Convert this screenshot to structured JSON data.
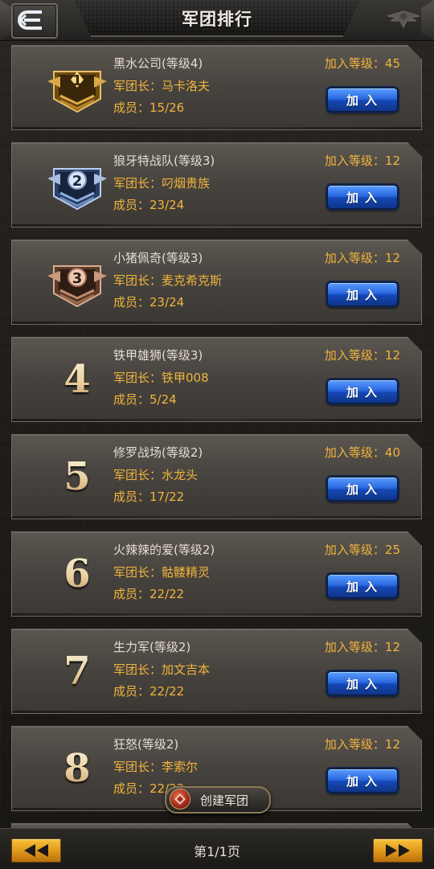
{
  "header": {
    "title": "军团排行",
    "back_icon": "back-arrow-icon",
    "emblem_icon": "winged-emblem-icon"
  },
  "legions": [
    {
      "rank": "1",
      "medal": "gold",
      "name": "黑水公司(等级4)",
      "leader": "军团长：马卡洛夫",
      "members": "成员：15/26",
      "join_level": "加入等级：45",
      "join_label": "加入"
    },
    {
      "rank": "2",
      "medal": "silver",
      "name": "狼牙特战队(等级3)",
      "leader": "军团长：叼烟贵族",
      "members": "成员：23/24",
      "join_level": "加入等级：12",
      "join_label": "加入"
    },
    {
      "rank": "3",
      "medal": "bronze",
      "name": "小猪佩奇(等级3)",
      "leader": "军团长：麦克希克斯",
      "members": "成员：23/24",
      "join_level": "加入等级：12",
      "join_label": "加入"
    },
    {
      "rank": "4",
      "name": "铁甲雄狮(等级3)",
      "leader": "军团长：铁甲008",
      "members": "成员：5/24",
      "join_level": "加入等级：12",
      "join_label": "加入"
    },
    {
      "rank": "5",
      "name": "修罗战场(等级2)",
      "leader": "军团长：水龙头",
      "members": "成员：17/22",
      "join_level": "加入等级：40",
      "join_label": "加入"
    },
    {
      "rank": "6",
      "name": "火辣辣的爱(等级2)",
      "leader": "军团长：骷髅精灵",
      "members": "成员：22/22",
      "join_level": "加入等级：25",
      "join_label": "加入"
    },
    {
      "rank": "7",
      "name": "生力军(等级2)",
      "leader": "军团长：加文吉本",
      "members": "成员：22/22",
      "join_level": "加入等级：12",
      "join_label": "加入"
    },
    {
      "rank": "8",
      "name": "狂怒(等级2)",
      "leader": "军团长：李索尔",
      "members": "成员：22/22",
      "join_level": "加入等级：12",
      "join_label": "加入"
    }
  ],
  "create_button": {
    "label": "创建军团",
    "icon": "create-legion-icon"
  },
  "footer": {
    "page_label": "第1/1页",
    "prev_icon": "double-left-arrow-icon",
    "next_icon": "double-right-arrow-icon"
  },
  "colors": {
    "accent_gold": "#f0b43c",
    "join_blue": "#2b69e0",
    "pager_gold": "#e0961a"
  }
}
